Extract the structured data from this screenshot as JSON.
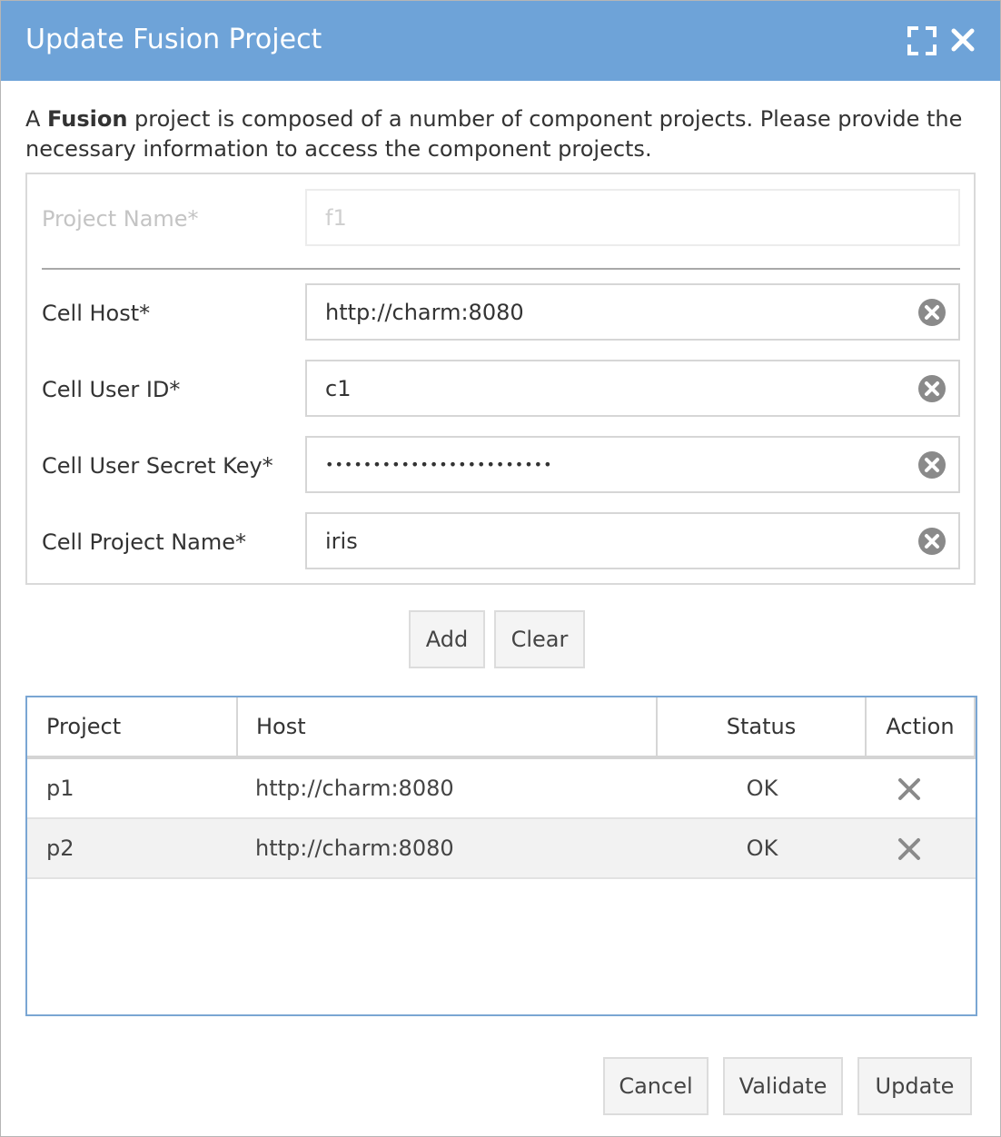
{
  "dialog": {
    "title": "Update Fusion Project",
    "icons": {
      "maximize": "maximize-icon",
      "close": "close-icon"
    }
  },
  "intro": {
    "prefix": "A ",
    "bold": "Fusion",
    "rest": " project is composed of a number of component projects. Please provide the necessary information to access the component projects."
  },
  "form": {
    "project_name": {
      "label": "Project Name*",
      "value": "f1"
    },
    "cell_host": {
      "label": "Cell Host*",
      "value": "http://charm:8080"
    },
    "cell_user_id": {
      "label": "Cell User ID*",
      "value": "c1"
    },
    "cell_secret_key": {
      "label": "Cell User Secret Key*",
      "value": "••••••••••••••••••••••••"
    },
    "cell_project_name": {
      "label": "Cell Project Name*",
      "value": "iris"
    }
  },
  "form_actions": {
    "add": "Add",
    "clear": "Clear"
  },
  "table": {
    "columns": [
      "Project",
      "Host",
      "Status",
      "Action"
    ],
    "rows": [
      {
        "project": "p1",
        "host": "http://charm:8080",
        "status": "OK"
      },
      {
        "project": "p2",
        "host": "http://charm:8080",
        "status": "OK"
      }
    ]
  },
  "footer": {
    "cancel": "Cancel",
    "validate": "Validate",
    "update": "Update"
  },
  "colors": {
    "titlebar": "#6ea3d8",
    "table_border": "#7aa6d3"
  }
}
